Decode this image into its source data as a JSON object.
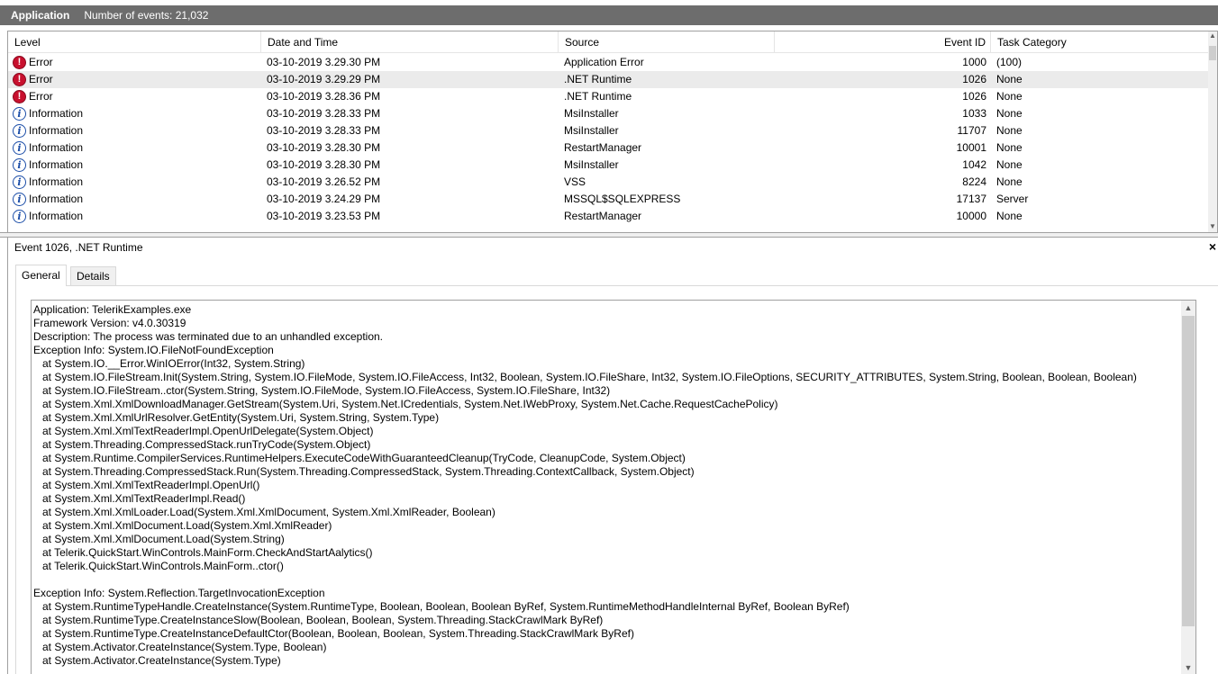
{
  "titlebar": {
    "log_name": "Application",
    "event_count": "Number of events: 21,032"
  },
  "grid": {
    "columns": {
      "level": "Level",
      "date_time": "Date and Time",
      "source": "Source",
      "event_id": "Event ID",
      "task_category": "Task Category"
    },
    "rows": [
      {
        "level": "Error",
        "icon": "error-icon",
        "date": "03-10-2019 3.29.30 PM",
        "source": "Application Error",
        "event_id": "1000",
        "category": "(100)"
      },
      {
        "level": "Error",
        "icon": "error-icon",
        "date": "03-10-2019 3.29.29 PM",
        "source": ".NET Runtime",
        "event_id": "1026",
        "category": "None",
        "selected": true
      },
      {
        "level": "Error",
        "icon": "error-icon",
        "date": "03-10-2019 3.28.36 PM",
        "source": ".NET Runtime",
        "event_id": "1026",
        "category": "None"
      },
      {
        "level": "Information",
        "icon": "info-icon",
        "date": "03-10-2019 3.28.33 PM",
        "source": "MsiInstaller",
        "event_id": "1033",
        "category": "None"
      },
      {
        "level": "Information",
        "icon": "info-icon",
        "date": "03-10-2019 3.28.33 PM",
        "source": "MsiInstaller",
        "event_id": "11707",
        "category": "None"
      },
      {
        "level": "Information",
        "icon": "info-icon",
        "date": "03-10-2019 3.28.30 PM",
        "source": "RestartManager",
        "event_id": "10001",
        "category": "None"
      },
      {
        "level": "Information",
        "icon": "info-icon",
        "date": "03-10-2019 3.28.30 PM",
        "source": "MsiInstaller",
        "event_id": "1042",
        "category": "None"
      },
      {
        "level": "Information",
        "icon": "info-icon",
        "date": "03-10-2019 3.26.52 PM",
        "source": "VSS",
        "event_id": "8224",
        "category": "None"
      },
      {
        "level": "Information",
        "icon": "info-icon",
        "date": "03-10-2019 3.24.29 PM",
        "source": "MSSQL$SQLEXPRESS",
        "event_id": "17137",
        "category": "Server"
      },
      {
        "level": "Information",
        "icon": "info-icon",
        "date": "03-10-2019 3.23.53 PM",
        "source": "RestartManager",
        "event_id": "10000",
        "category": "None"
      }
    ]
  },
  "detail": {
    "title": "Event 1026, .NET Runtime",
    "close_glyph": "×",
    "tabs": {
      "general": "General",
      "details": "Details"
    },
    "message_lines": [
      "Application: TelerikExamples.exe",
      "Framework Version: v4.0.30319",
      "Description: The process was terminated due to an unhandled exception.",
      "Exception Info: System.IO.FileNotFoundException",
      "   at System.IO.__Error.WinIOError(Int32, System.String)",
      "   at System.IO.FileStream.Init(System.String, System.IO.FileMode, System.IO.FileAccess, Int32, Boolean, System.IO.FileShare, Int32, System.IO.FileOptions, SECURITY_ATTRIBUTES, System.String, Boolean, Boolean, Boolean)",
      "   at System.IO.FileStream..ctor(System.String, System.IO.FileMode, System.IO.FileAccess, System.IO.FileShare, Int32)",
      "   at System.Xml.XmlDownloadManager.GetStream(System.Uri, System.Net.ICredentials, System.Net.IWebProxy, System.Net.Cache.RequestCachePolicy)",
      "   at System.Xml.XmlUrlResolver.GetEntity(System.Uri, System.String, System.Type)",
      "   at System.Xml.XmlTextReaderImpl.OpenUrlDelegate(System.Object)",
      "   at System.Threading.CompressedStack.runTryCode(System.Object)",
      "   at System.Runtime.CompilerServices.RuntimeHelpers.ExecuteCodeWithGuaranteedCleanup(TryCode, CleanupCode, System.Object)",
      "   at System.Threading.CompressedStack.Run(System.Threading.CompressedStack, System.Threading.ContextCallback, System.Object)",
      "   at System.Xml.XmlTextReaderImpl.OpenUrl()",
      "   at System.Xml.XmlTextReaderImpl.Read()",
      "   at System.Xml.XmlLoader.Load(System.Xml.XmlDocument, System.Xml.XmlReader, Boolean)",
      "   at System.Xml.XmlDocument.Load(System.Xml.XmlReader)",
      "   at System.Xml.XmlDocument.Load(System.String)",
      "   at Telerik.QuickStart.WinControls.MainForm.CheckAndStartAalytics()",
      "   at Telerik.QuickStart.WinControls.MainForm..ctor()",
      "",
      "Exception Info: System.Reflection.TargetInvocationException",
      "   at System.RuntimeTypeHandle.CreateInstance(System.RuntimeType, Boolean, Boolean, Boolean ByRef, System.RuntimeMethodHandleInternal ByRef, Boolean ByRef)",
      "   at System.RuntimeType.CreateInstanceSlow(Boolean, Boolean, Boolean, System.Threading.StackCrawlMark ByRef)",
      "   at System.RuntimeType.CreateInstanceDefaultCtor(Boolean, Boolean, Boolean, System.Threading.StackCrawlMark ByRef)",
      "   at System.Activator.CreateInstance(System.Type, Boolean)",
      "   at System.Activator.CreateInstance(System.Type)"
    ]
  },
  "colors": {
    "titlebar_bg": "#6d6d6d",
    "selected_row": "#ebebeb",
    "error_red": "#c8102e",
    "info_blue": "#1c4ea8"
  }
}
